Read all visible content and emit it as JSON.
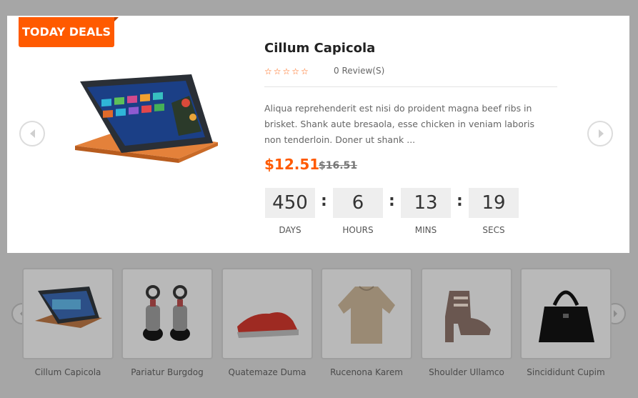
{
  "deal": {
    "ribbon": "TODAY DEALS",
    "title": "Cillum Capicola",
    "rating_stars": "☆☆☆☆☆",
    "rating_value": 0,
    "reviews": "0 Review(S)",
    "description": "Aliqua reprehenderit est nisi do proident magna beef ribs in brisket. Shank aute bresaola, esse chicken in veniam laboris non tenderloin. Doner ut shank ...",
    "price": "$12.51",
    "old_price": "$16.51",
    "image_icon": "laptop-tablet-icon",
    "countdown": {
      "days": "450",
      "days_label": "DAYS",
      "hours": "6",
      "hours_label": "HOURS",
      "mins": "13",
      "mins_label": "MINS",
      "secs": "19",
      "secs_label": "SECS",
      "separator": ":"
    }
  },
  "thumbnails": [
    {
      "name": "Cillum Capicola",
      "icon": "laptop-tablet-icon"
    },
    {
      "name": "Pariatur Burgdog",
      "icon": "sandals-icon"
    },
    {
      "name": "Quatemaze Duma",
      "icon": "sneaker-icon"
    },
    {
      "name": "Rucenona Karem",
      "icon": "sweater-icon"
    },
    {
      "name": "Shoulder Ullamco",
      "icon": "heel-boot-icon"
    },
    {
      "name": "Sincididunt Cupim",
      "icon": "handbag-icon"
    }
  ],
  "colors": {
    "accent": "#ff5a00",
    "overlay": "#a6a6a6",
    "card": "#ffffff"
  }
}
